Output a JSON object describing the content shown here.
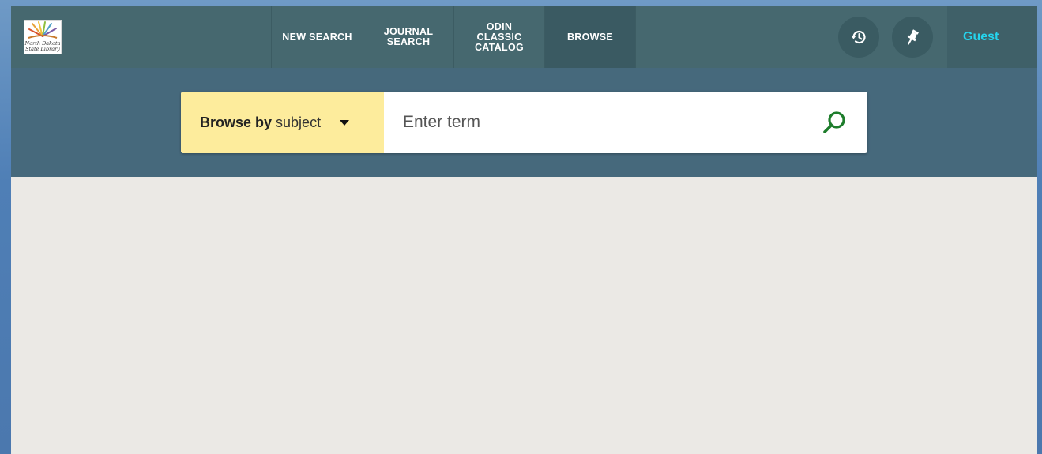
{
  "header": {
    "logo_text": "North Dakota State Library",
    "nav": [
      {
        "label": "NEW SEARCH"
      },
      {
        "label": "JOURNAL\nSEARCH"
      },
      {
        "label": "ODIN\nCLASSIC\nCATALOG"
      },
      {
        "label": "BROWSE",
        "active": true
      }
    ],
    "icons": {
      "history": "history-icon",
      "pin": "pin-icon"
    },
    "user_label": "Guest"
  },
  "search": {
    "browse_by_label": "Browse by",
    "browse_by_value": "subject",
    "term_placeholder": "Enter term",
    "term_value": ""
  },
  "colors": {
    "topbar": "#46686f",
    "searchband": "#46697c",
    "browse_active": "#3a5a62",
    "guest": "#25d4ee",
    "dropdown": "#fdec9c",
    "search_icon": "#1e7d2c",
    "content_bg": "#ebe9e5"
  }
}
